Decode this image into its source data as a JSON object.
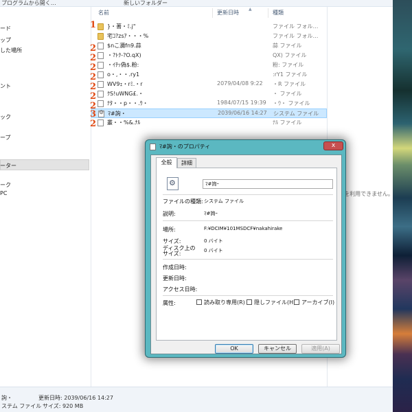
{
  "toolbar": {
    "left_text": "プログラムから開く…",
    "share_text": "新しいフォルダー"
  },
  "nav": {
    "items": [
      "ード",
      "ップ",
      "した場所",
      "ント",
      "ック",
      "ープ",
      "ーター",
      "ーク",
      "PC"
    ],
    "selected": "ーター"
  },
  "list": {
    "columns": {
      "name": "名前",
      "date": "更新日時",
      "type": "種類"
    },
    "rows": [
      {
        "name": "}・蓍・ﾐ.j\"",
        "date": "",
        "type": "ファイル フォル…",
        "kind": "folder"
      },
      {
        "name": "宅ｺ?zsｱ・・・%",
        "date": "",
        "type": "ファイル フォル…",
        "kind": "folder"
      },
      {
        "name": "$nこ瀰fn9.蒜",
        "date": "",
        "type": "蒜 ファイル",
        "kind": "file"
      },
      {
        "name": "・?ﾄｸ-?O.qX)",
        "date": "",
        "type": "QX) ファイル",
        "kind": "file"
      },
      {
        "name": "・ｲﾁｯ偽$.粉:",
        "date": "",
        "type": "粉: ファイル",
        "kind": "file"
      },
      {
        "name": "o・,・・.ry1",
        "date": "",
        "type": ":rY1 ファイル",
        "kind": "file"
      },
      {
        "name": "WV9ｪ・rﾐ.・r",
        "date": "2079/04/08 9:22",
        "type": "・R ファイル",
        "kind": "file"
      },
      {
        "name": "ｸS!uWNG£.・",
        "date": "",
        "type": "・ ファイル",
        "kind": "file"
      },
      {
        "name": "ﾅﾀ・・p・・.ｳ・",
        "date": "1984/07/15 19:39",
        "type": "・ｳ・ ファイル",
        "kind": "file"
      },
      {
        "name": "ﾏ#詢・",
        "date": "2039/06/16 14:27",
        "type": "システム ファイル",
        "kind": "sys",
        "selected": true
      },
      {
        "name": "叢・・%&.ﾅﾙ",
        "date": "",
        "type": "ﾅﾙ ファイル",
        "kind": "file"
      }
    ],
    "annotations": [
      "1",
      "2",
      "3"
    ]
  },
  "preview": {
    "message": "ューを利用できません。"
  },
  "status": {
    "name": "詢・",
    "modified_label": "更新日時: 2039/06/16 14:27",
    "type": "ステム ファイル",
    "size_label": "サイズ: 920 MB"
  },
  "dialog": {
    "title": "ﾏ#詢・のプロパティ",
    "close": "x",
    "tabs": [
      "全般",
      "詳細"
    ],
    "active_tab": "全般",
    "filename": "ﾏ#詢ｰ",
    "fields": {
      "file_type_label": "ファイルの種類:",
      "file_type": "システム ファイル",
      "description_label": "説明:",
      "description": "ﾏ#詢ｰ",
      "location_label": "場所:",
      "location": "F:¥DCIM¥101MSDCF¥nakahirake",
      "size_label": "サイズ:",
      "size": "0 バイト",
      "disk_size_label": "ディスク上のサイズ:",
      "disk_size": "0 バイト",
      "created_label": "作成日時:",
      "modified_label": "更新日時:",
      "accessed_label": "アクセス日時:",
      "attributes_label": "属性:"
    },
    "attributes": {
      "readonly": "読み取り専用(R)",
      "hidden": "隠しファイル(H)",
      "archive": "アーカイブ(I)"
    },
    "buttons": {
      "ok": "OK",
      "cancel": "キャンセル",
      "apply": "適用(A)"
    }
  }
}
